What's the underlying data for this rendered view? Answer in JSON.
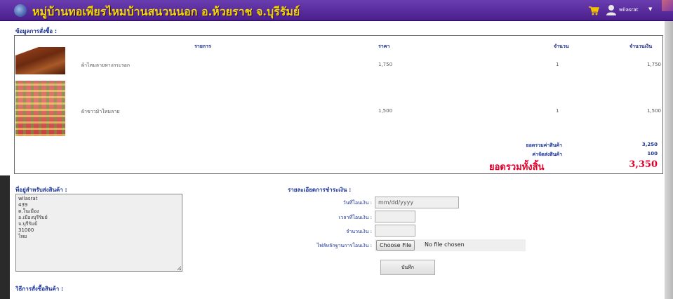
{
  "header": {
    "title": "หมู่บ้านทอเพียรไหมบ้านสนวนนอก อ.ห้วยราช จ.บุรีรัมย์",
    "user_name": "wilasrat",
    "caret": "▼"
  },
  "order": {
    "section_label": "ข้อมูลการสั่งซื้อ :",
    "columns": {
      "item": "รายการ",
      "price": "ราคา",
      "qty": "จำนวน",
      "total": "จำนวนเงิน"
    },
    "rows": [
      {
        "name": "ผ้าไหมลายหางกระรอก",
        "price": "1,750",
        "qty": "1",
        "total": "1,750"
      },
      {
        "name": "ผ้าขาวม้าไหมลาย",
        "price": "1,500",
        "qty": "1",
        "total": "1,500"
      }
    ],
    "subtotal_label": "ยอดรวมค่าสินค้า",
    "subtotal_value": "3,250",
    "shipping_label": "ค่าจัดส่งสินค้า",
    "shipping_value": "100",
    "grand_label": "ยอดรวมทั้งสิ้น",
    "grand_value": "3,350"
  },
  "shipping_address": {
    "section_label": "ที่อยู่สำหรับส่งสินค้า :",
    "lines": [
      "wilasrat",
      "439",
      "ต.ในเมือง",
      "อ.เมืองบุรีรัมย์",
      "จ.บุรีรัมย์",
      "31000",
      "ไทย"
    ]
  },
  "payment": {
    "section_label": "รายละเอียดการชำระเงิน :",
    "date_label": "วันที่โอนเงิน :",
    "date_placeholder": "mm/dd/yyyy",
    "time_label": "เวลาที่โอนเงิน :",
    "time_value": "",
    "amount_label": "จำนวนเงิน :",
    "amount_value": "",
    "slip_label": "ไฟล์หลักฐานการโอนเงิน :",
    "file_button": "Choose File",
    "file_status": "No file chosen",
    "save_button": "บันทึก"
  },
  "order_method": {
    "section_label": "วิธีการสั่งซื้อสินค้า :"
  },
  "icons": {
    "logo": "globe-logo-icon",
    "cart": "cart-icon",
    "user": "user-icon"
  },
  "colors": {
    "header_bg": "#4b1e8c",
    "title": "#f5d800",
    "link_blue": "#1a3399",
    "grand_total": "#e0002a"
  }
}
